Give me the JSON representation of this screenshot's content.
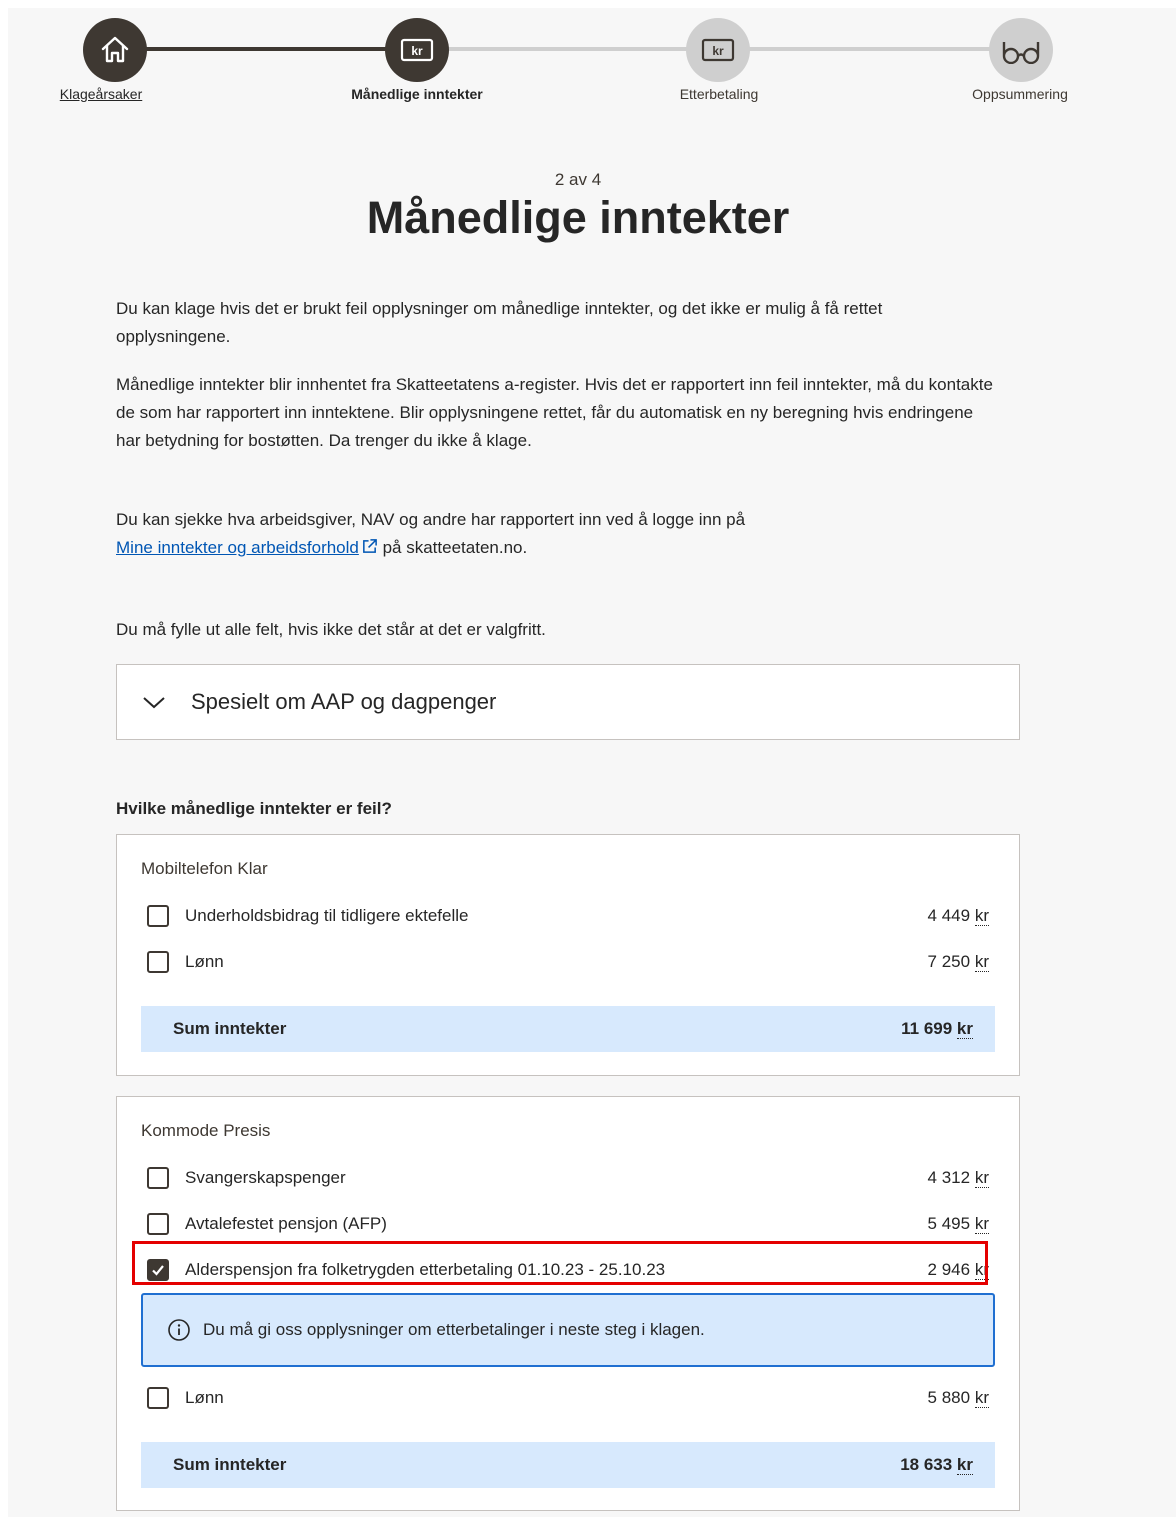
{
  "stepper": {
    "steps": [
      {
        "label": "Klageårsaker",
        "icon": "home-icon"
      },
      {
        "label": "Månedlige inntekter",
        "icon": "kr-icon"
      },
      {
        "label": "Etterbetaling",
        "icon": "kr-icon"
      },
      {
        "label": "Oppsummering",
        "icon": "glasses-icon"
      }
    ],
    "kr_text": "kr"
  },
  "counter": "2 av 4",
  "title": "Månedlige inntekter",
  "intro": {
    "p1": "Du kan klage hvis det er brukt feil opplysninger om månedlige inntekter, og det ikke er mulig å få rettet opplysningene.",
    "p2": "Månedlige inntekter blir innhentet fra Skatteetatens a-register. Hvis det er rapportert inn feil inntekter, må du kontakte de som har rapportert inn inntektene. Blir opplysningene rettet, får du automatisk en ny beregning hvis endringene har betydning for bostøtten. Da trenger du ikke å klage.",
    "p3_before": "Du kan sjekke hva arbeidsgiver, NAV og andre har rapportert inn ved å logge inn på",
    "p3_link": "Mine inntekter og arbeidsforhold",
    "p3_after": " på skatteetaten.no.",
    "p4": "Du må fylle ut alle felt, hvis ikke det står at det er valgfritt."
  },
  "accordion": {
    "label": "Spesielt om AAP og dagpenger",
    "icon": "chevron-down-icon"
  },
  "question": "Hvilke månedlige inntekter er feil?",
  "currency": "kr",
  "cards": [
    {
      "title": "Mobiltelefon Klar",
      "items": [
        {
          "label": "Underholdsbidrag til tidligere ektefelle",
          "amount": "4 449",
          "checked": false
        },
        {
          "label": "Lønn",
          "amount": "7 250",
          "checked": false
        }
      ],
      "sum_label": "Sum inntekter",
      "sum_amount": "11 699"
    },
    {
      "title": "Kommode Presis",
      "items": [
        {
          "label": "Svangerskapspenger",
          "amount": "4 312",
          "checked": false
        },
        {
          "label": "Avtalefestet pensjon (AFP)",
          "amount": "5 495",
          "checked": false
        },
        {
          "label": "Alderspensjon fra folketrygden etterbetaling 01.10.23 - 25.10.23",
          "amount": "2 946",
          "checked": true
        },
        {
          "label": "Lønn",
          "amount": "5 880",
          "checked": false
        }
      ],
      "info": "Du må gi oss opplysninger om etterbetalinger i neste steg i klagen.",
      "sum_label": "Sum inntekter",
      "sum_amount": "18 633"
    }
  ]
}
